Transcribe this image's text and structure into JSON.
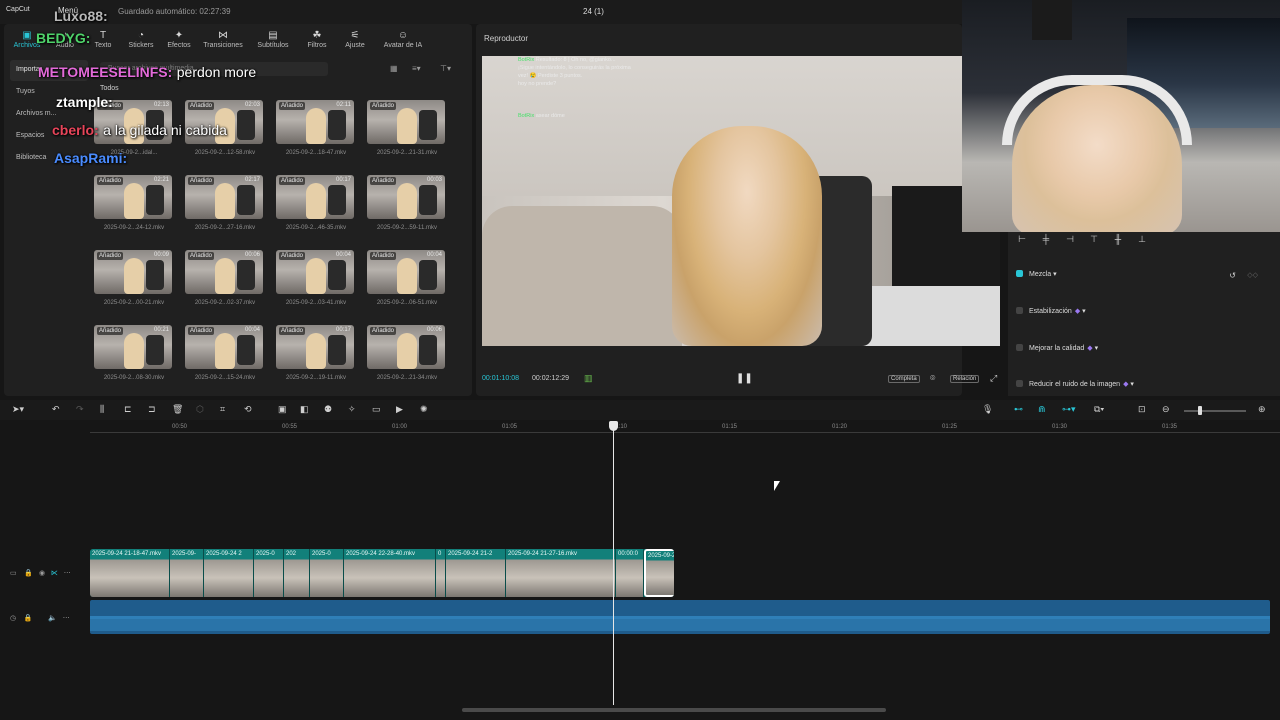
{
  "topbar": {
    "logo": "CapCut",
    "menu": "Menú",
    "autosave": "Guardado automático: 02:27:39",
    "project_title": "24 (1)"
  },
  "toolbar": {
    "items": [
      {
        "label": "Archivos",
        "icon": "media-icon"
      },
      {
        "label": "Audio",
        "icon": "audio-icon"
      },
      {
        "label": "Texto",
        "icon": "text-icon"
      },
      {
        "label": "Stickers",
        "icon": "sticker-icon"
      },
      {
        "label": "Efectos",
        "icon": "effects-icon"
      },
      {
        "label": "Transiciones",
        "icon": "transition-icon"
      },
      {
        "label": "Subtítulos",
        "icon": "subtitle-icon"
      },
      {
        "label": "Filtros",
        "icon": "filter-icon"
      },
      {
        "label": "Ajuste",
        "icon": "adjust-icon"
      },
      {
        "label": "Avatar de IA",
        "icon": "ai-avatar-icon"
      }
    ]
  },
  "sidebar": {
    "items": [
      {
        "label": "Importar"
      },
      {
        "label": "Tuyos"
      },
      {
        "label": "Archivos m..."
      },
      {
        "label": "Espacios"
      },
      {
        "label": "Biblioteca"
      }
    ]
  },
  "media": {
    "import_label": "Importar",
    "record_label": "Grabar",
    "search_placeholder": "Buscar archivos multimedia",
    "section": "Todos",
    "cards": [
      {
        "badge": "Añadido",
        "duration": "02:13",
        "name": "2025-09-2...idal..."
      },
      {
        "badge": "Añadido",
        "duration": "02:03",
        "name": "2025-09-2...12-58.mkv"
      },
      {
        "badge": "Añadido",
        "duration": "02:11",
        "name": "2025-09-2...18-47.mkv"
      },
      {
        "badge": "Añadido",
        "duration": "",
        "name": "2025-09-2...21-31.mkv"
      },
      {
        "badge": "Añadido",
        "duration": "02:21",
        "name": "2025-09-2...24-12.mkv"
      },
      {
        "badge": "Añadido",
        "duration": "02:17",
        "name": "2025-09-2...27-16.mkv"
      },
      {
        "badge": "Añadido",
        "duration": "00:17",
        "name": "2025-09-2...46-35.mkv"
      },
      {
        "badge": "Añadido",
        "duration": "00:03",
        "name": "2025-09-2...59-11.mkv"
      },
      {
        "badge": "Añadido",
        "duration": "00:09",
        "name": "2025-09-2...00-21.mkv"
      },
      {
        "badge": "Añadido",
        "duration": "00:06",
        "name": "2025-09-2...02-37.mkv"
      },
      {
        "badge": "Añadido",
        "duration": "00:04",
        "name": "2025-09-2...03-41.mkv"
      },
      {
        "badge": "Añadido",
        "duration": "00:04",
        "name": "2025-09-2...06-51.mkv"
      },
      {
        "badge": "Añadido",
        "duration": "00:21",
        "name": "2025-09-2...08-30.mkv"
      },
      {
        "badge": "Añadido",
        "duration": "00:04",
        "name": "2025-09-2...15-24.mkv"
      },
      {
        "badge": "Añadido",
        "duration": "00:17",
        "name": "2025-09-2...19-11.mkv"
      },
      {
        "badge": "Añadido",
        "duration": "00:06",
        "name": "2025-09-2...21-34.mkv"
      }
    ]
  },
  "player": {
    "title": "Reproductor",
    "current_time": "00:01:10:08",
    "total_time": "00:02:12:29",
    "full_label": "Completa",
    "ratio_label": "Relación",
    "chat_overlay": [
      {
        "user": "BotRix",
        "text": "Resultado: 8 | Oh no, @gianko..."
      },
      {
        "user": "",
        "text": "¡Sigue intentándolo, lo conseguirás la próxima"
      },
      {
        "user": "",
        "text": "vez! 😢 Perdiste 3 puntos."
      },
      {
        "user": "",
        "text": "hoy no prende?"
      },
      {
        "user": "BotRix",
        "text": "asear dóme"
      }
    ]
  },
  "right_panel": {
    "options": [
      {
        "label": "Mezcla",
        "checked": true,
        "premium": false
      },
      {
        "label": "Estabilización",
        "checked": false,
        "premium": true
      },
      {
        "label": "Mejorar la calidad",
        "checked": false,
        "premium": true
      },
      {
        "label": "Reducir el ruido de la imagen",
        "checked": false,
        "premium": true
      }
    ]
  },
  "timeline": {
    "ruler_ticks": [
      "00:50",
      "00:55",
      "01:00",
      "01:05",
      "01:10",
      "01:15",
      "01:20",
      "01:25",
      "01:30",
      "01:35"
    ],
    "clips": [
      {
        "label": "2025-09-24 21-18-47.mkv"
      },
      {
        "label": "2025-09-"
      },
      {
        "label": "2025-09-24 2"
      },
      {
        "label": "2025-0"
      },
      {
        "label": "202"
      },
      {
        "label": "2025-0"
      },
      {
        "label": "2025-09-24 22-28-40.mkv"
      },
      {
        "label": "0"
      },
      {
        "label": "2025-09-24 21-2"
      },
      {
        "label": "2025-09-24 21-27-16.mkv"
      },
      {
        "label": "00:00:0"
      },
      {
        "label": "2025-09-24"
      }
    ]
  },
  "stream_chat": [
    {
      "user": "Luxo88:",
      "color": "#b8b8b8",
      "message": ""
    },
    {
      "user": "BEDYG:",
      "color": "#4fd36a",
      "message": ""
    },
    {
      "user": "METOMEESELINFS:",
      "color": "#e36ad9",
      "message": "perdon more"
    },
    {
      "user": "ztample:",
      "color": "#ffffff",
      "message": ""
    },
    {
      "user": "cberlo:",
      "color": "#e8455a",
      "message": "a la gilada ni cabida"
    },
    {
      "user": "AsapRami:",
      "color": "#4a8cff",
      "message": ""
    }
  ],
  "colors": {
    "accent": "#29c6d6",
    "video_track": "#0f6e6a",
    "audio_track": "#1f5c8c",
    "premium": "#9a78f0"
  }
}
